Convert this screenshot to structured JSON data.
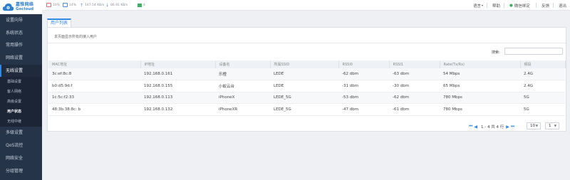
{
  "brand": {
    "name_cn": "嘉惟网络",
    "name_en": "Gocloud",
    "accent": "#2f87e6",
    "sidebar_bg": "#26344a"
  },
  "topbar": {
    "stats": [
      {
        "icon": "cpu-icon",
        "value": "10%",
        "color": "#e86a6a"
      },
      {
        "icon": "memory-icon",
        "value": "14%",
        "color": "#4a90e2"
      },
      {
        "icon": "upload-arrow-icon",
        "value": "147.54 KB/s"
      },
      {
        "icon": "download-arrow-icon",
        "value": "86.91 KB/s"
      },
      {
        "icon": "monitor-icon",
        "value": "4",
        "color": "#35b35f"
      }
    ],
    "language": "语言",
    "help": "帮助",
    "wechat": "微信绑定",
    "feedback": "反馈",
    "logout": "退出"
  },
  "sidebar": {
    "items": [
      "设置向导",
      "系统状态",
      "常用操作",
      "网络设置",
      "无线设置"
    ],
    "sub_items": [
      "基础设置",
      "客人网络",
      "高级设置",
      "用户状态",
      "无线中继"
    ],
    "items_after": [
      "多级设置",
      "QoS流控",
      "网络安全",
      "分组管理"
    ]
  },
  "tab": {
    "label": "用户列表"
  },
  "panel": {
    "description": "本页面显示所有的接入用户"
  },
  "search": {
    "label": "搜索:",
    "value": ""
  },
  "table": {
    "headers": [
      "MAC地址",
      "IP地址",
      "设备名",
      "所属SSID",
      "RSSI0",
      "RSSI1",
      "Rate(Tx/Rx)",
      "频段"
    ],
    "rows": [
      [
        "3c:ef:8c:8",
        "192.168.0.161",
        "乐橙",
        "LEDE",
        "-62 dbm",
        "-63 dbm",
        "54 Mbps",
        "2.4G"
      ],
      [
        "b0:d5:9d:f",
        "192.168.0.155",
        "小蚁云台",
        "LEDE",
        "-31 dbm",
        "-30 dbm",
        "65 Mbps",
        "2.4G"
      ],
      [
        "1c:5c:f2:33",
        "192.168.0.113",
        "iPhoneX",
        "LEDE_5G",
        "-53 dbm",
        "-62 dbm",
        "780 Mbps",
        "5G"
      ],
      [
        "48:3b:38:8c:  b",
        "192.168.0.132",
        "iPhoneXR",
        "LEDE_5G",
        "-47 dbm",
        "-61 dbm",
        "780 Mbps",
        "5G"
      ]
    ]
  },
  "pager": {
    "summary": "1 - 4 共 4 行",
    "page_size": "10",
    "page": "1"
  }
}
